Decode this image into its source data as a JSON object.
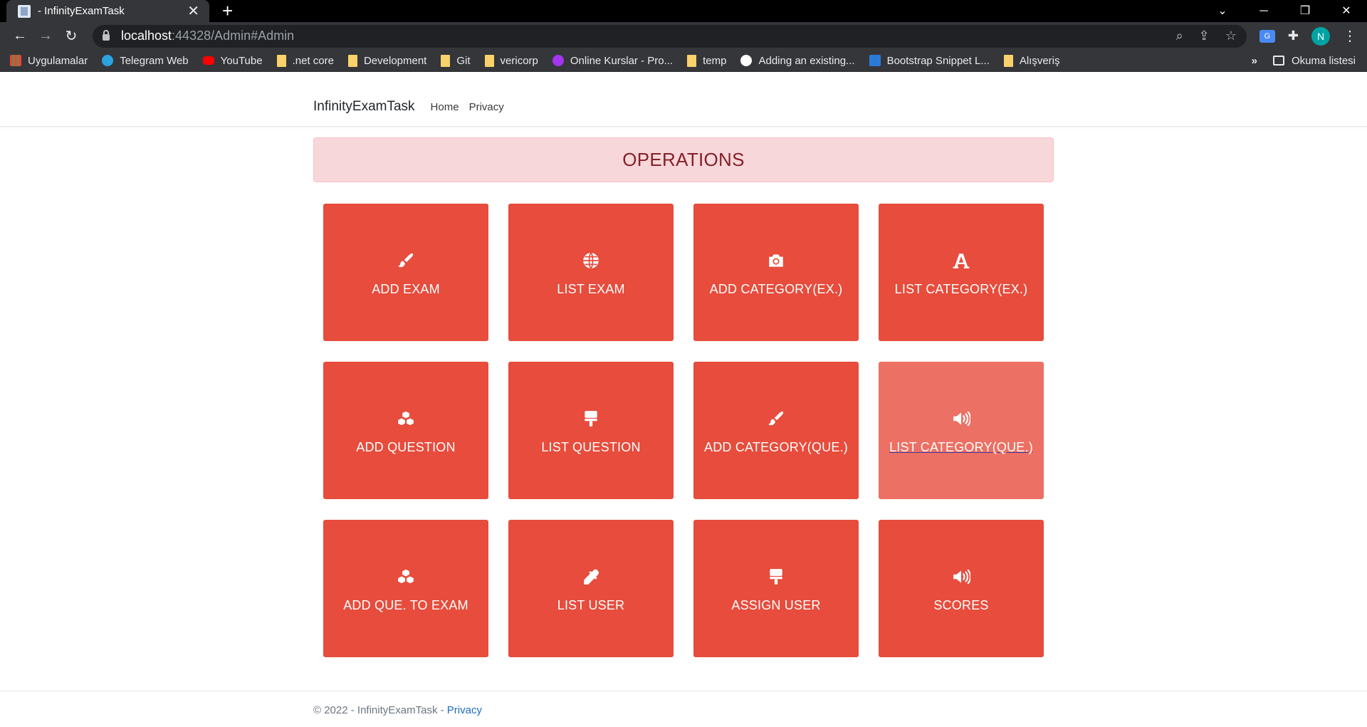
{
  "browser": {
    "tab_title": "- InfinityExamTask",
    "tab_close": "✕",
    "new_tab": "+",
    "url_host": "localhost",
    "url_path": ":44328/Admin#Admin",
    "profile_initial": "N",
    "bookmarks": [
      {
        "label": "Uygulamalar",
        "icon": "apps-icon"
      },
      {
        "label": "Telegram Web",
        "icon": "telegram-icon"
      },
      {
        "label": "YouTube",
        "icon": "youtube-icon"
      },
      {
        "label": ".net core",
        "icon": "folder-icon"
      },
      {
        "label": "Development",
        "icon": "folder-icon"
      },
      {
        "label": "Git",
        "icon": "folder-icon"
      },
      {
        "label": "vericorp",
        "icon": "folder-icon"
      },
      {
        "label": "Online Kurslar - Pro...",
        "icon": "udemy-icon"
      },
      {
        "label": "temp",
        "icon": "folder-icon"
      },
      {
        "label": "Adding an existing...",
        "icon": "github-icon"
      },
      {
        "label": "Bootstrap Snippet L...",
        "icon": "bootstrap-icon"
      },
      {
        "label": "Alışveriş",
        "icon": "folder-icon"
      }
    ],
    "bookmarks_more": "»",
    "reading_list": "Okuma listesi"
  },
  "navbar": {
    "brand": "InfinityExamTask",
    "links": [
      "Home",
      "Privacy"
    ]
  },
  "operations": {
    "title": "OPERATIONS",
    "tiles": [
      {
        "label": "ADD EXAM",
        "icon": "brush-icon"
      },
      {
        "label": "LIST EXAM",
        "icon": "globe-icon"
      },
      {
        "label": "ADD CATEGORY(EX.)",
        "icon": "camera-icon"
      },
      {
        "label": "LIST CATEGORY(EX.)",
        "icon": "font-icon"
      },
      {
        "label": "ADD QUESTION",
        "icon": "cubes-icon"
      },
      {
        "label": "LIST QUESTION",
        "icon": "paint-roller-icon"
      },
      {
        "label": "ADD CATEGORY(QUE.)",
        "icon": "brush-icon"
      },
      {
        "label": "LIST CATEGORY(QUE.)",
        "icon": "volume-icon"
      },
      {
        "label": "ADD QUE. TO EXAM",
        "icon": "cubes-icon"
      },
      {
        "label": "LIST USER",
        "icon": "eyedropper-icon"
      },
      {
        "label": "ASSIGN USER",
        "icon": "paint-roller-icon"
      },
      {
        "label": "SCORES",
        "icon": "volume-icon"
      }
    ],
    "tile_color": "#e74c3c",
    "tile_hover_color": "#ec7063"
  },
  "footer": {
    "copyright": "© 2022 - InfinityExamTask - ",
    "privacy": "Privacy"
  }
}
